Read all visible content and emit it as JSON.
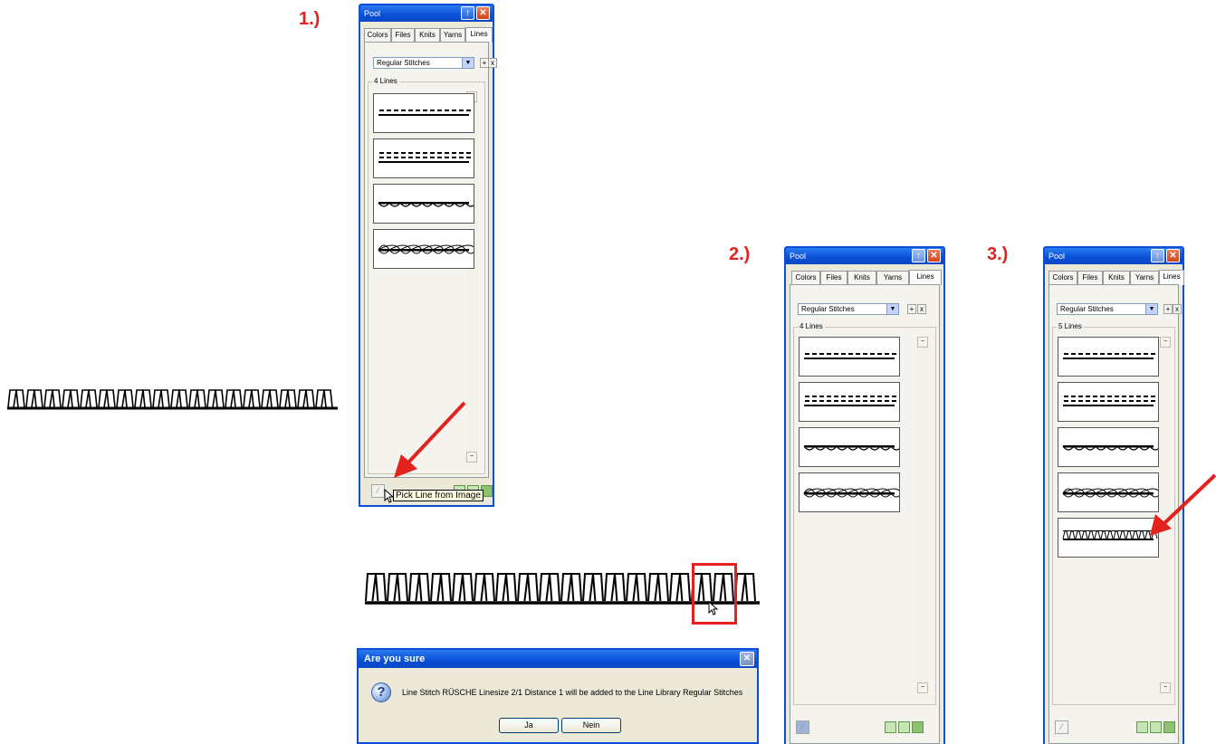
{
  "steps": [
    "1.)",
    "2.)",
    "3.)"
  ],
  "pool": {
    "title": "Pool",
    "tabs": [
      "Colors",
      "Files",
      "Knits",
      "Yarns",
      "Lines"
    ],
    "active_tab": "Lines",
    "library_select": "Regular Stitches",
    "add_label": "+",
    "remove_label": "x",
    "group_label_4": "4 Lines",
    "group_label_5": "5 Lines",
    "line_items": [
      "dashed-line",
      "double-dashed-line",
      "wavy-stitch-line",
      "scalloped-stitch-line"
    ],
    "new_line_item": "ruesche-stitch-line"
  },
  "tooltip": "Pick Line from Image",
  "dialog": {
    "title": "Are you sure",
    "message": "Line Stitch RÜSCHE Linesize 2/1 Distance 1 will be added to the Line Library Regular Stitches",
    "yes_label": "Ja",
    "no_label": "Nein"
  },
  "colors": {
    "accent_red": "#e3211d",
    "titlebar_blue": "#0a4fd6",
    "window_bg": "#ece9d8"
  }
}
